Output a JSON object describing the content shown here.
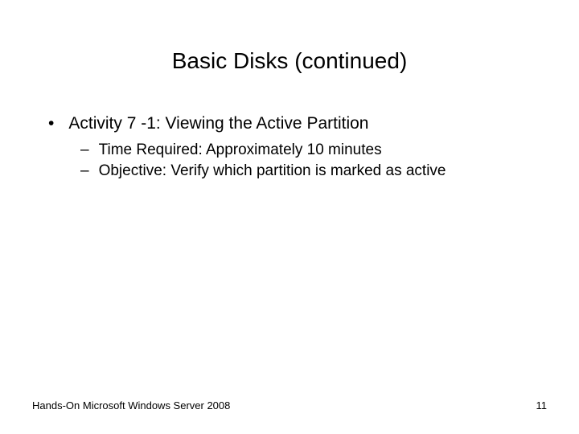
{
  "slide": {
    "title": "Basic Disks (continued)",
    "bullets": {
      "activity": "Activity 7 -1: Viewing the Active Partition",
      "time": "Time Required: Approximately 10 minutes",
      "objective": "Objective: Verify which partition is marked as active"
    },
    "footer": {
      "text": "Hands-On Microsoft Windows Server 2008",
      "page": "11"
    },
    "markers": {
      "dot": "•",
      "dash": "–"
    }
  }
}
